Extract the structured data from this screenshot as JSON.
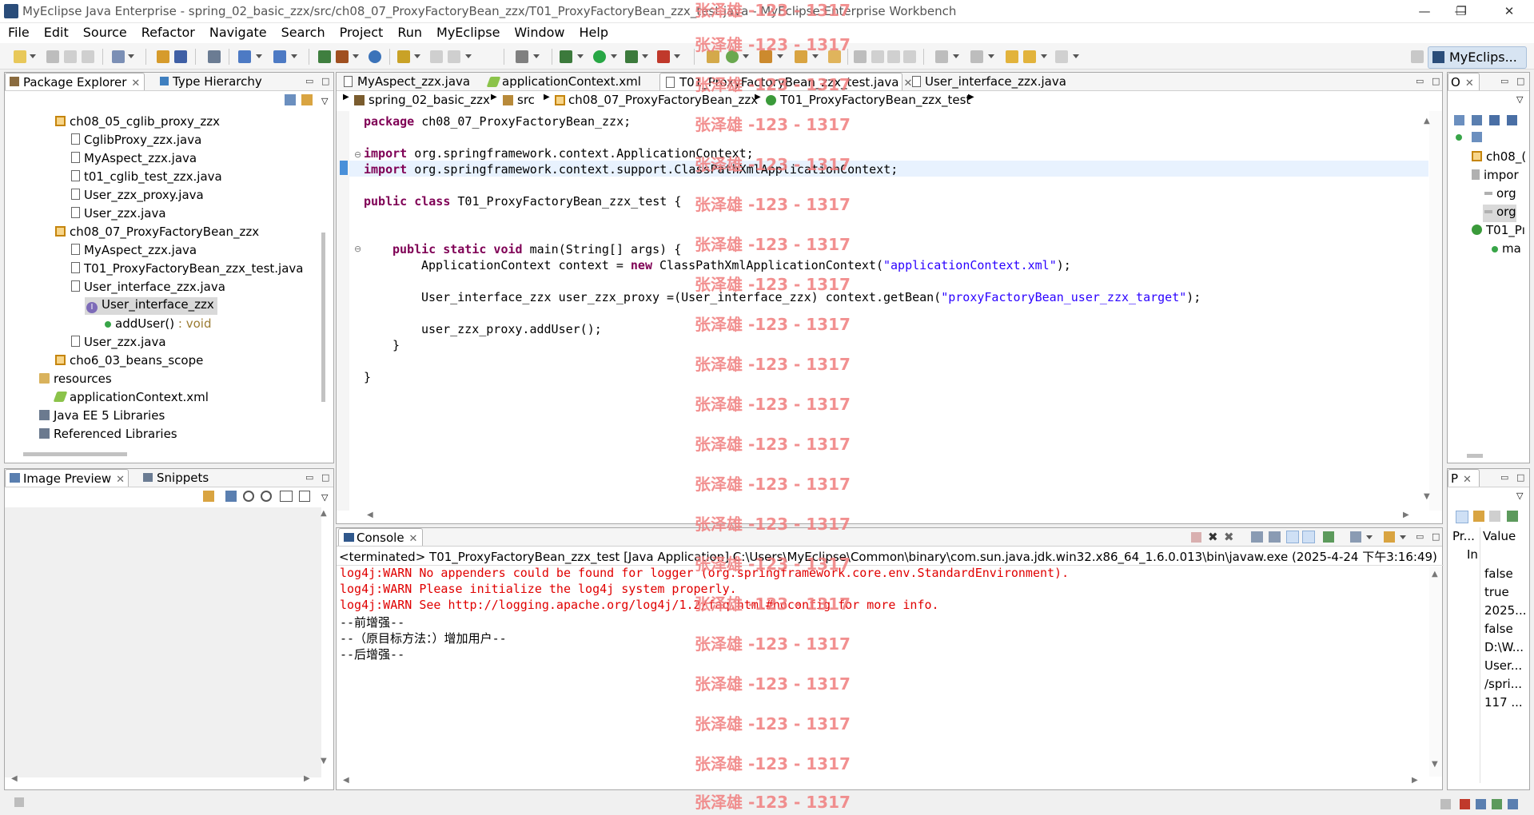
{
  "window": {
    "title": "MyEclipse Java Enterprise - spring_02_basic_zzx/src/ch08_07_ProxyFactoryBean_zzx/T01_ProxyFactoryBean_zzx_test.java - MyEclipse Enterprise Workbench",
    "minimize": "—",
    "maximize": "❐",
    "close": "✕"
  },
  "menu": [
    "File",
    "Edit",
    "Source",
    "Refactor",
    "Navigate",
    "Search",
    "Project",
    "Run",
    "MyEclipse",
    "Window",
    "Help"
  ],
  "perspective": "MyEclips...",
  "package_explorer": {
    "tabs": [
      "Package Explorer",
      "Type Hierarchy"
    ],
    "items": [
      {
        "label": "ch08_05_cglib_proxy_zzx",
        "icon": "package-icon"
      },
      {
        "label": "CglibProxy_zzx.java",
        "icon": "java-file-icon"
      },
      {
        "label": "MyAspect_zzx.java",
        "icon": "java-file-icon"
      },
      {
        "label": "t01_cglib_test_zzx.java",
        "icon": "java-file-icon"
      },
      {
        "label": "User_zzx_proxy.java",
        "icon": "java-file-icon"
      },
      {
        "label": "User_zzx.java",
        "icon": "java-file-icon"
      },
      {
        "label": "ch08_07_ProxyFactoryBean_zzx",
        "icon": "package-icon"
      },
      {
        "label": "MyAspect_zzx.java",
        "icon": "java-file-icon"
      },
      {
        "label": "T01_ProxyFactoryBean_zzx_test.java",
        "icon": "java-file-icon"
      },
      {
        "label": "User_interface_zzx.java",
        "icon": "java-file-icon"
      },
      {
        "label": "User_interface_zzx",
        "icon": "interface-icon"
      },
      {
        "label": "addUser()",
        "suffix": " : void",
        "icon": "method-icon"
      },
      {
        "label": "User_zzx.java",
        "icon": "java-file-icon"
      },
      {
        "label": "cho6_03_beans_scope",
        "icon": "package-icon"
      },
      {
        "label": "resources",
        "icon": "folder-icon"
      },
      {
        "label": "applicationContext.xml",
        "icon": "xml-file-icon"
      },
      {
        "label": "Java EE 5 Libraries",
        "icon": "library-icon"
      },
      {
        "label": "Referenced Libraries",
        "icon": "library-icon"
      }
    ]
  },
  "image_preview": {
    "tabs": [
      "Image Preview",
      "Snippets"
    ]
  },
  "editor": {
    "tabs": [
      "MyAspect_zzx.java",
      "applicationContext.xml",
      "T01_ProxyFactoryBean_zzx_test.java",
      "User_interface_zzx.java"
    ],
    "breadcrumb": [
      "spring_02_basic_zzx",
      "src",
      "ch08_07_ProxyFactoryBean_zzx",
      "T01_ProxyFactoryBean_zzx_test"
    ],
    "code": {
      "l1_kw": "package",
      "l1_rest": " ch08_07_ProxyFactoryBean_zzx;",
      "l2_kw": "import",
      "l2_rest": " org.springframework.context.ApplicationContext;",
      "l3_kw": "import",
      "l3_rest": " org.springframework.context.support.ClassPathXmlApplicationContext;",
      "l4_kw": "public class",
      "l4_rest": " T01_ProxyFactoryBean_zzx_test {",
      "l5_kw": "public static void",
      "l5_rest": " main(String[] args) {",
      "l6_a": "ApplicationContext context = ",
      "l6_kw": "new",
      "l6_b": " ClassPathXmlApplicationContext(",
      "l6_str": "\"applicationContext.xml\"",
      "l6_c": ");",
      "l7_a": "User_interface_zzx user_zzx_proxy =(User_interface_zzx) context.getBean(",
      "l7_str": "\"proxyFactoryBean_user_zzx_target\"",
      "l7_c": ");",
      "l8": "user_zzx_proxy.addUser();",
      "l9": "}",
      "l10": "}"
    }
  },
  "console": {
    "tab": "Console",
    "header": "<terminated> T01_ProxyFactoryBean_zzx_test [Java Application] C:\\Users\\MyEclipse\\Common\\binary\\com.sun.java.jdk.win32.x86_64_1.6.0.013\\bin\\javaw.exe (2025-4-24 下午3:16:49)",
    "lines": [
      {
        "text": "log4j:WARN No appenders could be found for logger (org.springframework.core.env.StandardEnvironment).",
        "error": true
      },
      {
        "text": "log4j:WARN Please initialize the log4j system properly.",
        "error": true
      },
      {
        "text": "log4j:WARN See http://logging.apache.org/log4j/1.2/faq.html#noconfig for more info.",
        "error": true
      },
      {
        "text": "--前增强--",
        "error": false
      },
      {
        "text": "--（原目标方法：）增加用户--",
        "error": false
      },
      {
        "text": "--后增强--",
        "error": false
      }
    ]
  },
  "outline": {
    "tab": "O",
    "items": [
      "ch08_(",
      "impor",
      "org",
      "org",
      "T01_Pı",
      "ma"
    ]
  },
  "properties": {
    "tab": "P",
    "headers": [
      "Pr...",
      "Value"
    ],
    "row0": "In",
    "values": [
      "false",
      "true",
      "2025...",
      "false",
      "D:\\W...",
      "User...",
      "/spri...",
      "117 ..."
    ]
  },
  "watermark": "张泽雄 -123 - 1317"
}
